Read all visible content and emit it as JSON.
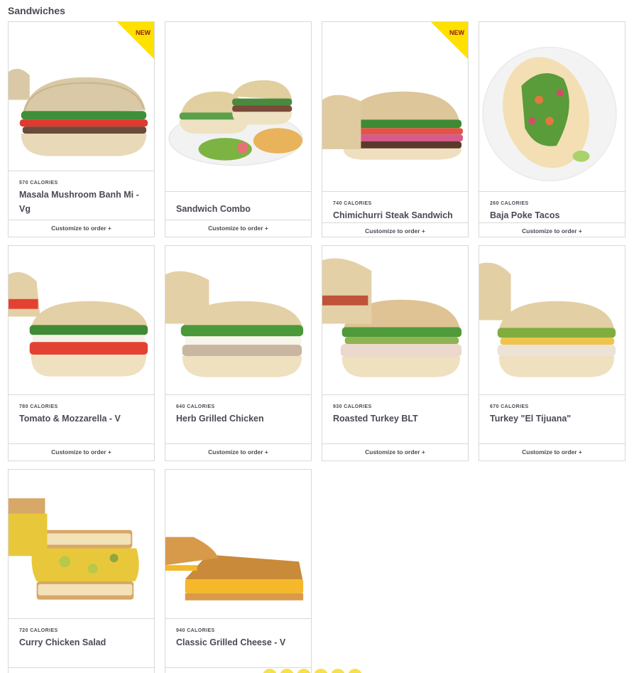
{
  "section": {
    "title": "Sandwiches"
  },
  "customize_label": "Customize to order +",
  "badge_label": "NEW",
  "colors": {
    "badge": "#ffe100",
    "border": "#d9d9d9",
    "text": "#4a4a55",
    "pager": "#f7e04a"
  },
  "items": [
    {
      "name": "Masala Mushroom Banh Mi - Vg",
      "calories": "570 CALORIES",
      "new": true,
      "image": "sandwich"
    },
    {
      "name": "Sandwich Combo",
      "calories": "",
      "new": false,
      "image": "combo-plate"
    },
    {
      "name": "Chimichurri Steak Sandwich",
      "calories": "740 CALORIES",
      "new": true,
      "image": "sandwich"
    },
    {
      "name": "Baja Poke Tacos",
      "calories": "260 CALORIES",
      "new": false,
      "image": "tacos-plate"
    },
    {
      "name": "Tomato & Mozzarella - V",
      "calories": "780 CALORIES",
      "new": false,
      "image": "sandwich"
    },
    {
      "name": "Herb Grilled Chicken",
      "calories": "640 CALORIES",
      "new": false,
      "image": "sandwich"
    },
    {
      "name": "Roasted Turkey BLT",
      "calories": "930 CALORIES",
      "new": false,
      "image": "sandwich"
    },
    {
      "name": "Turkey \"El Tijuana\"",
      "calories": "670 CALORIES",
      "new": false,
      "image": "sandwich"
    },
    {
      "name": "Curry Chicken Salad",
      "calories": "720 CALORIES",
      "new": false,
      "image": "toast-sandwich"
    },
    {
      "name": "Classic Grilled Cheese - V",
      "calories": "940 CALORIES",
      "new": false,
      "image": "grilled-cheese"
    }
  ]
}
